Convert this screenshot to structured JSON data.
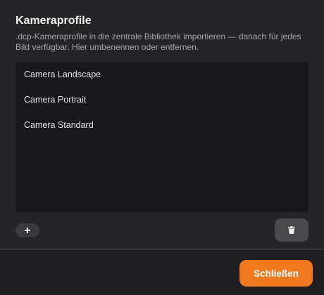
{
  "dialog": {
    "title": "Kameraprofile",
    "description": ".dcp-Kameraprofile in die zentrale Bibliothek importieren — danach für jedes Bild verfügbar. Hier umbenennen oder entfernen."
  },
  "profiles": {
    "items": [
      {
        "label": "Camera Landscape"
      },
      {
        "label": "Camera Portrait"
      },
      {
        "label": "Camera Standard"
      }
    ]
  },
  "actions": {
    "add_icon": "plus-icon",
    "delete_icon": "trash-icon"
  },
  "footer": {
    "close_label": "Schließen"
  },
  "colors": {
    "accent": "#f0781e",
    "background": "#252527",
    "list_background": "#18181a",
    "footer_background": "#1f1f21"
  }
}
